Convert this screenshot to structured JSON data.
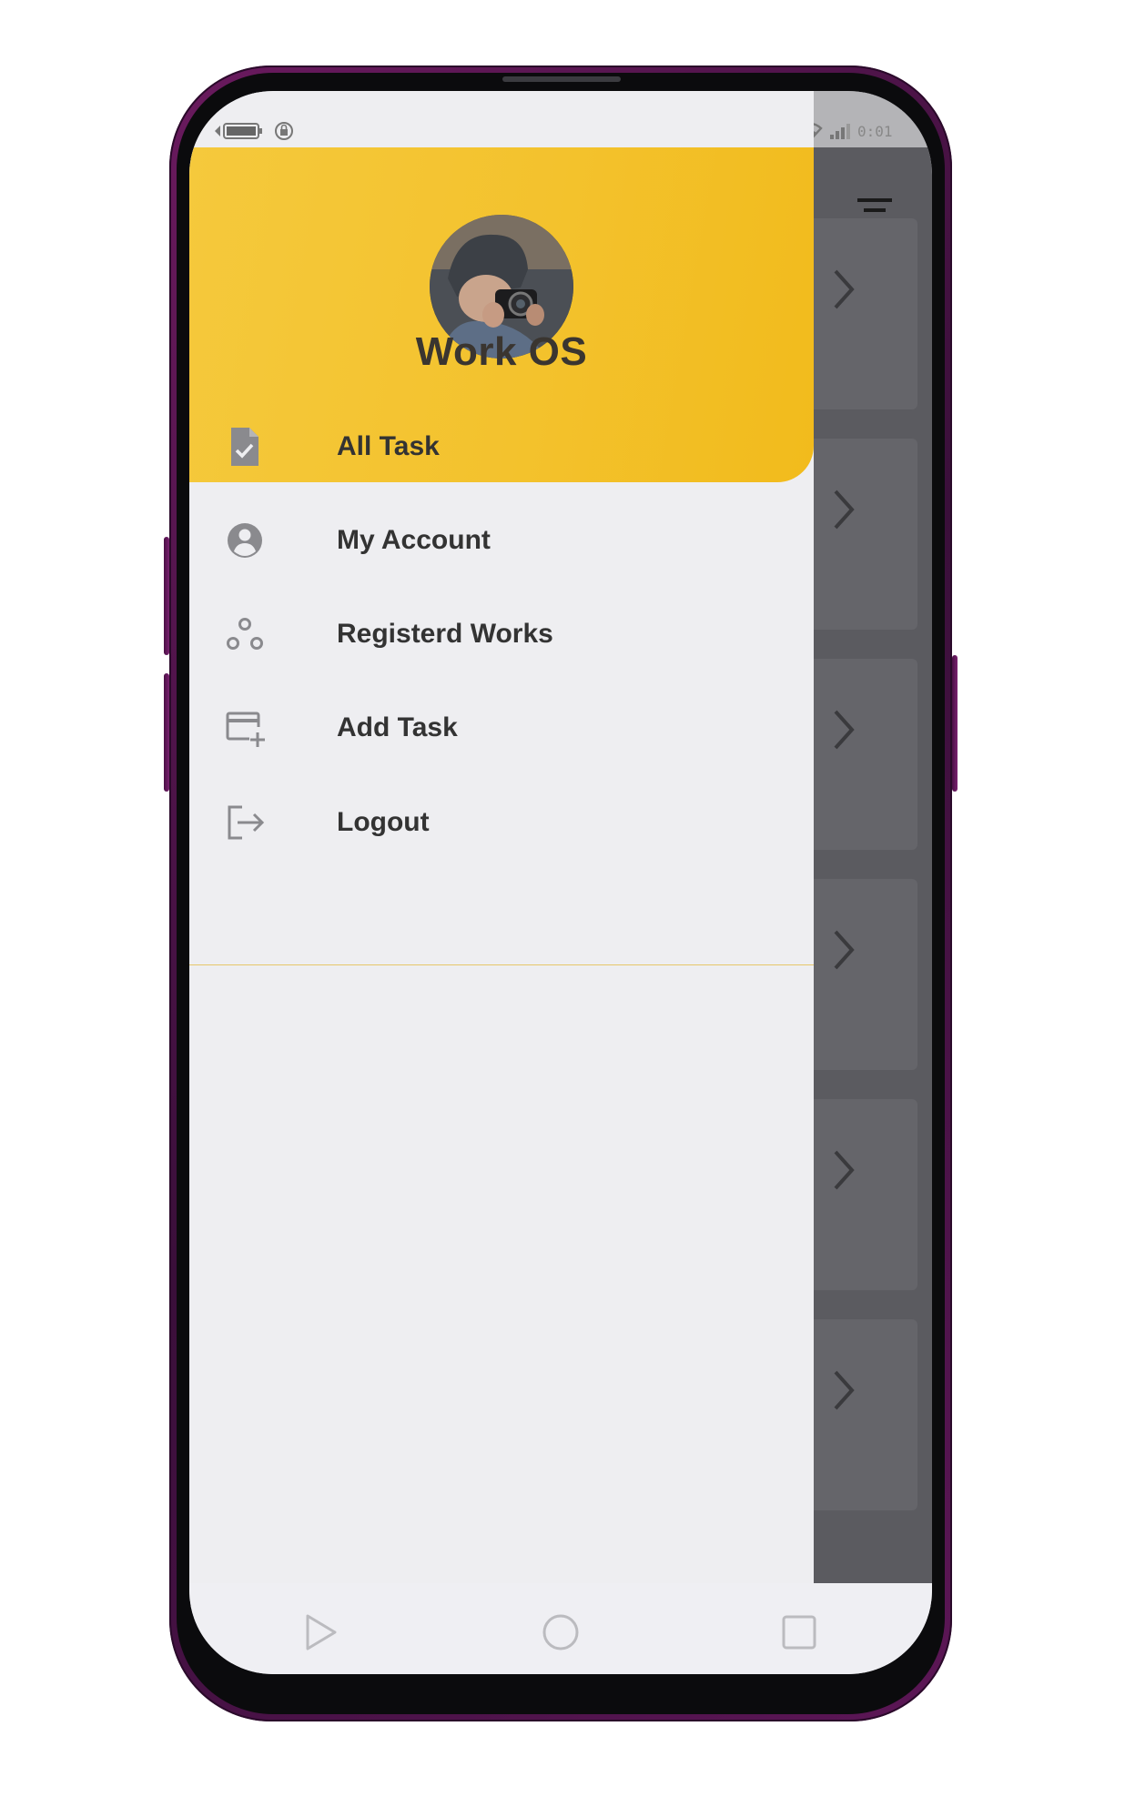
{
  "status_bar": {
    "time": "0:01"
  },
  "drawer": {
    "brand_title": "Work OS",
    "menu_items": [
      {
        "label": "All Task",
        "icon": "task-document-icon"
      },
      {
        "label": "My Account",
        "icon": "account-circle-icon"
      },
      {
        "label": "Registerd Works",
        "icon": "workflow-nodes-icon"
      },
      {
        "label": "Add Task",
        "icon": "add-card-icon"
      }
    ],
    "logout": {
      "label": "Logout",
      "icon": "logout-icon"
    }
  },
  "colors": {
    "accent_yellow": "#f3c22d",
    "drawer_bg": "#eeeef1",
    "scrim_gray": "#5b5b60",
    "text_dark": "#333333",
    "icon_gray": "#8a8a8e",
    "phone_frame": "#5c1656"
  }
}
